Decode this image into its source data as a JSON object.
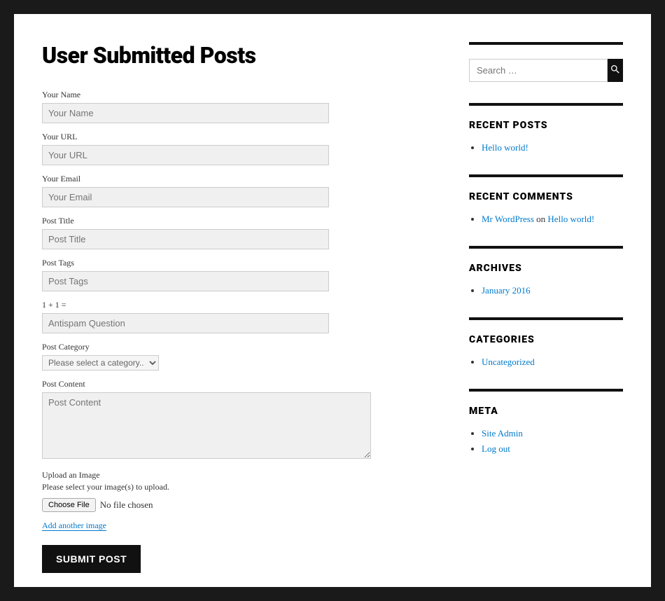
{
  "page": {
    "title": "User Submitted Posts"
  },
  "form": {
    "name_label": "Your Name",
    "name_placeholder": "Your Name",
    "url_label": "Your URL",
    "url_placeholder": "Your URL",
    "email_label": "Your Email",
    "email_placeholder": "Your Email",
    "title_label": "Post Title",
    "title_placeholder": "Post Title",
    "tags_label": "Post Tags",
    "tags_placeholder": "Post Tags",
    "antispam_label": "1 + 1 =",
    "antispam_placeholder": "Antispam Question",
    "category_label": "Post Category",
    "category_selected": "Please select a category..",
    "content_label": "Post Content",
    "content_placeholder": "Post Content",
    "upload_label": "Upload an Image",
    "upload_desc": "Please select your image(s) to upload.",
    "choose_file": "Choose File",
    "no_file": "No file chosen",
    "add_image": "Add another image",
    "submit": "SUBMIT POST"
  },
  "sidebar": {
    "search_placeholder": "Search …",
    "recent_posts": {
      "heading": "RECENT POSTS",
      "items": [
        "Hello world!"
      ]
    },
    "recent_comments": {
      "heading": "RECENT COMMENTS",
      "author": "Mr WordPress",
      "on": "on",
      "post": "Hello world!"
    },
    "archives": {
      "heading": "ARCHIVES",
      "items": [
        "January 2016"
      ]
    },
    "categories": {
      "heading": "CATEGORIES",
      "items": [
        "Uncategorized"
      ]
    },
    "meta": {
      "heading": "META",
      "items": [
        "Site Admin",
        "Log out"
      ]
    }
  }
}
